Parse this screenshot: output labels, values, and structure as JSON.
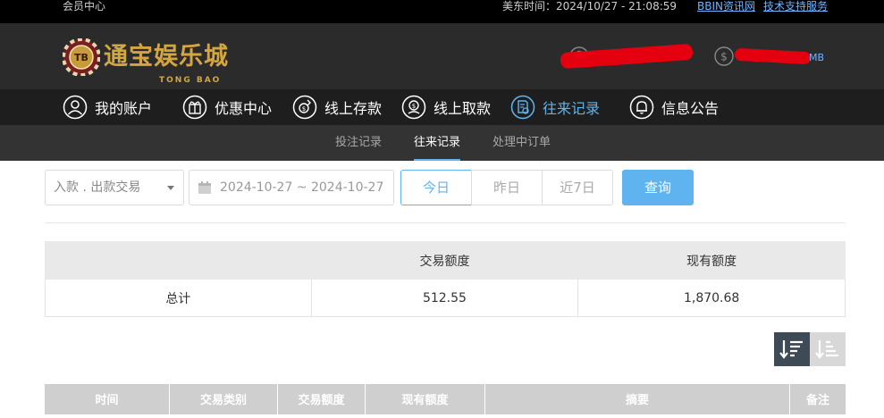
{
  "topbar": {
    "member_center": "会员中心",
    "time_label": "美东时间：2024/10/27 - 21:08:59",
    "link_bbin": "BBIN资讯网",
    "link_support": "技术支持服务"
  },
  "header": {
    "logo_text": "通宝娱乐城",
    "logo_sub": "TONG BAO",
    "logo_badge": "TB",
    "currency": "MB"
  },
  "nav": {
    "items": [
      {
        "label": "我的账户",
        "icon": "user-icon"
      },
      {
        "label": "优惠中心",
        "icon": "gift-icon"
      },
      {
        "label": "线上存款",
        "icon": "deposit-icon"
      },
      {
        "label": "线上取款",
        "icon": "withdraw-icon"
      },
      {
        "label": "往来记录",
        "icon": "records-icon"
      },
      {
        "label": "信息公告",
        "icon": "bell-icon"
      }
    ],
    "active_index": 4
  },
  "subnav": {
    "items": [
      "投注记录",
      "往来记录",
      "处理中订单"
    ],
    "active_index": 1
  },
  "filter": {
    "type_value": "入款 . 出款交易",
    "date_range": "2024-10-27 ~ 2024-10-27",
    "quick": [
      "今日",
      "昨日",
      "近7日"
    ],
    "quick_active": 0,
    "query_label": "查询"
  },
  "summary": {
    "headers": [
      "",
      "交易额度",
      "现有额度"
    ],
    "row": [
      "总计",
      "512.55",
      "1,870.68"
    ]
  },
  "records": {
    "columns": [
      "时间",
      "交易类别",
      "交易额度",
      "现有额度",
      "摘要",
      "备注"
    ]
  },
  "colors": {
    "accent": "#5fb4ef",
    "gold": "#d4a640",
    "redaction": "#e5000f"
  }
}
